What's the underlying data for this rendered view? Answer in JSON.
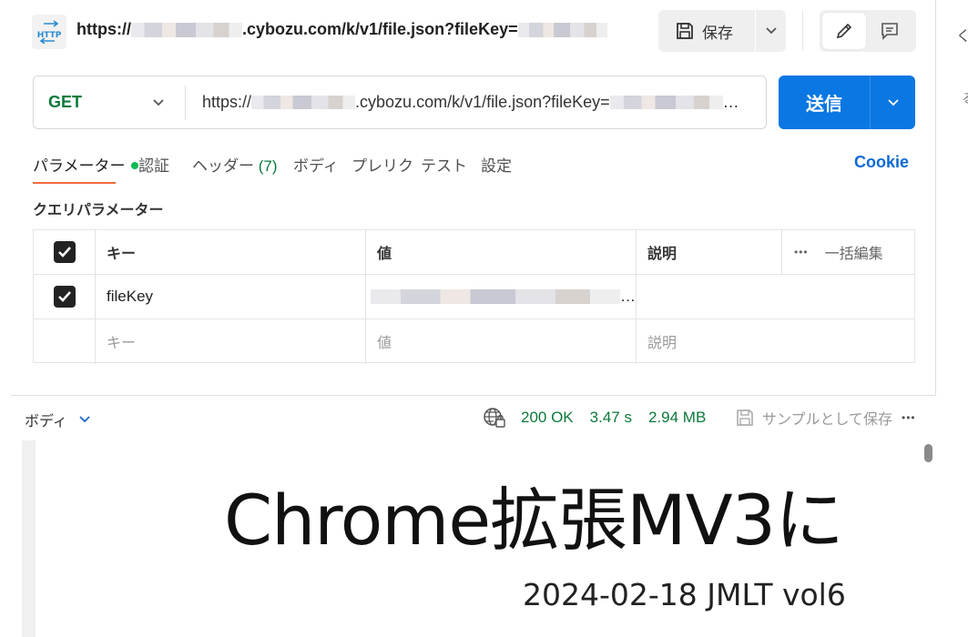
{
  "header": {
    "badge_text": "HTTP",
    "title_prefix": "https://",
    "title_domain": ".cybozu.com/k/v1/file.json?fileKey=",
    "save_label": "保存"
  },
  "request": {
    "method": "GET",
    "url_prefix": "https://",
    "url_domain": ".cybozu.com/k/v1/file.json?fileKey=",
    "url_suffix": "…",
    "send_label": "送信"
  },
  "tabs": [
    {
      "label": "パラメーター",
      "active": true
    },
    {
      "label": "認証"
    },
    {
      "label": "ヘッダー",
      "count": "(7)"
    },
    {
      "label": "ボディ"
    },
    {
      "label": "プレリク"
    },
    {
      "label": "テスト"
    },
    {
      "label": "設定"
    }
  ],
  "cookie_label": "Cookie",
  "query_params": {
    "section_title": "クエリパラメーター",
    "headers": {
      "key": "キー",
      "value": "値",
      "description": "説明",
      "more": "•••",
      "bulk_edit": "一括編集"
    },
    "rows": [
      {
        "checked": true,
        "key": "fileKey",
        "value_suffix": "…",
        "description": ""
      }
    ],
    "placeholder": {
      "key": "キー",
      "value": "値",
      "description": "説明"
    }
  },
  "response": {
    "body_label": "ボディ",
    "status": "200 OK",
    "time": "3.47 s",
    "size": "2.94 MB",
    "save_example": "サンプルとして保存",
    "more": "•••",
    "preview": {
      "title": "Chrome拡張MV3に",
      "subtitle": "2024-02-18 JMLT vol6"
    }
  },
  "colors": {
    "accent": "#0a77e2",
    "active_tab_underline": "#f26b3a",
    "method_get": "#0b7a3b",
    "status_ok": "#0b7a3b",
    "cookie_link": "#0a6ad4"
  },
  "right_panel": {
    "fragment_top": "く/",
    "fragment_mid": "る"
  }
}
